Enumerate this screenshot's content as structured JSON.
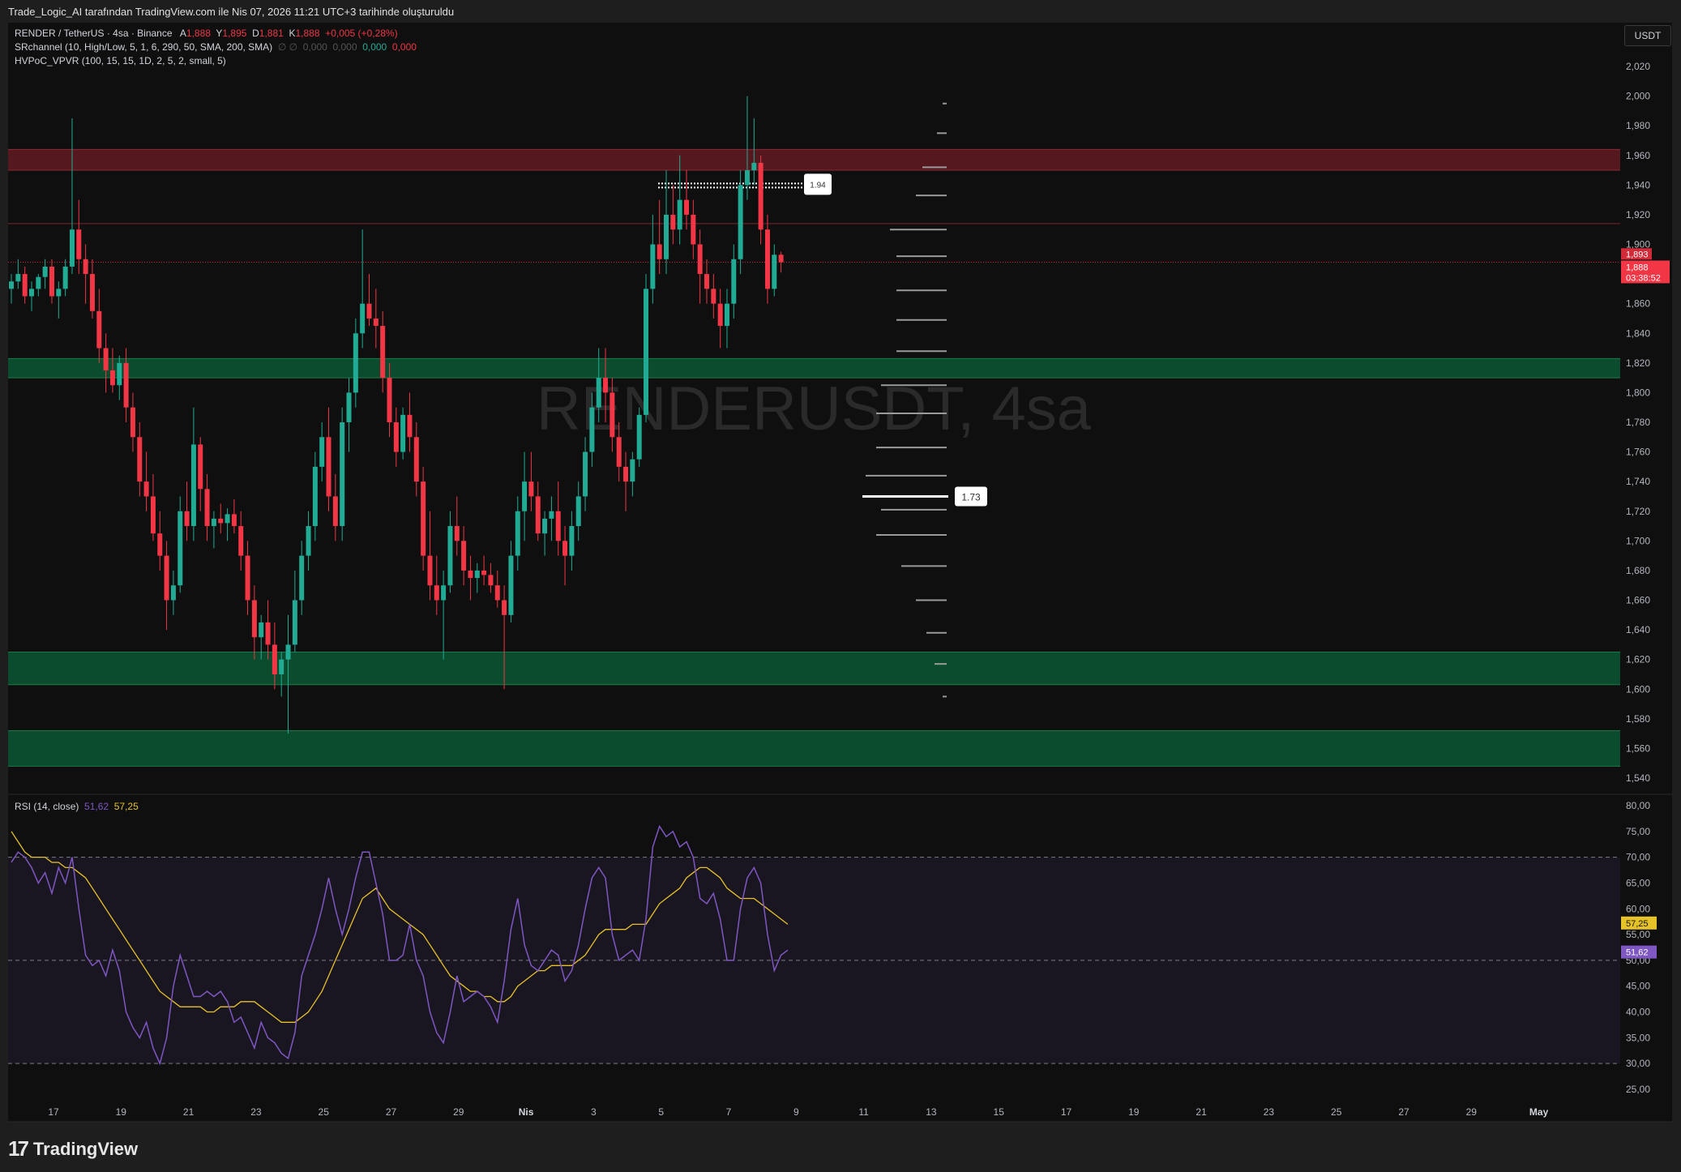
{
  "header": {
    "snapshot_note": "Trade_Logic_AI tarafından TradingView.com ile Nis 07, 2026 11:21 UTC+3 tarihinde oluşturuldu"
  },
  "legend": {
    "symbol": "RENDER / TetherUS · 4sa · Binance",
    "open_label": "A",
    "open": "1,888",
    "high_label": "Y",
    "high": "1,895",
    "low_label": "D",
    "low": "1,881",
    "close_label": "K",
    "close": "1,888",
    "change": "+0,005 (+0,28%)",
    "indicator1": "SRchannel (10, High/Low, 5, 1, 6, 290, 50, SMA, 200, SMA)",
    "indicator1_sym": "∅ ∅",
    "indicator1_vals": [
      "0,000",
      "0,000",
      "0,000",
      "0,000"
    ],
    "indicator2": "HVPoC_VPVR (100, 15, 15, 1D, 2, 5, 2, small, 5)",
    "rsi": "RSI (14, close)",
    "rsi_value": "51,62",
    "rsi_ma_value": "57,25"
  },
  "watermark": "RENDERUSDT, 4sa",
  "currency_button": "USDT",
  "branding": {
    "logo_mark": "17",
    "logo_word": "TradingView"
  },
  "colors": {
    "up": "#22ab94",
    "down": "#f23645",
    "resistance": "#5c1a20",
    "support": "#0c5030",
    "rsi": "#7e57c2",
    "rsi_ma": "#e6c229"
  },
  "chart_data": [
    {
      "type": "candlestick",
      "title": "RENDER / TetherUS · 4sa · Binance",
      "ylim": [
        1.53,
        2.035
      ],
      "y_ticks": [
        "2,020",
        "2,000",
        "1,980",
        "1,960",
        "1,940",
        "1,920",
        "1,900",
        "1,880",
        "1,860",
        "1,840",
        "1,820",
        "1,800",
        "1,780",
        "1,760",
        "1,740",
        "1,720",
        "1,700",
        "1,680",
        "1,660",
        "1,640",
        "1,620",
        "1,600",
        "1,580",
        "1,560",
        "1,540"
      ],
      "x_ticks": [
        "17",
        "19",
        "21",
        "23",
        "25",
        "27",
        "29",
        "Nis",
        "3",
        "5",
        "7",
        "9",
        "11",
        "13",
        "15",
        "17",
        "19",
        "21",
        "23",
        "25",
        "27",
        "29",
        "May"
      ],
      "price_labels": {
        "line": "1,893",
        "last": "1,888",
        "countdown": "03:38:52"
      },
      "zones": [
        {
          "kind": "resistance",
          "from": 1.95,
          "to": 1.964
        },
        {
          "kind": "support",
          "from": 1.81,
          "to": 1.823
        },
        {
          "kind": "support",
          "from": 1.603,
          "to": 1.625
        },
        {
          "kind": "support",
          "from": 1.548,
          "to": 1.572
        }
      ],
      "lines": [
        {
          "kind": "resistance-line",
          "price": 1.914
        },
        {
          "kind": "last-price",
          "price": 1.888
        }
      ],
      "poc_labels": [
        {
          "price": 1.94,
          "text": "1.94"
        },
        {
          "price": 1.73,
          "text": "1.73"
        }
      ],
      "volume_profile": [
        [
          1.995,
          0.05
        ],
        [
          1.975,
          0.12
        ],
        [
          1.952,
          0.3
        ],
        [
          1.933,
          0.38
        ],
        [
          1.91,
          0.7
        ],
        [
          1.892,
          0.62
        ],
        [
          1.869,
          0.62
        ],
        [
          1.849,
          0.62
        ],
        [
          1.828,
          0.62
        ],
        [
          1.805,
          0.81
        ],
        [
          1.786,
          0.87
        ],
        [
          1.763,
          0.87
        ],
        [
          1.744,
          1.0
        ],
        [
          1.721,
          0.81
        ],
        [
          1.704,
          0.87
        ],
        [
          1.683,
          0.56
        ],
        [
          1.66,
          0.38
        ],
        [
          1.638,
          0.25
        ],
        [
          1.617,
          0.15
        ],
        [
          1.595,
          0.05
        ]
      ],
      "ohlc": [
        [
          1.87,
          1.88,
          1.86,
          1.875
        ],
        [
          1.875,
          1.89,
          1.87,
          1.88
        ],
        [
          1.88,
          1.885,
          1.86,
          1.865
        ],
        [
          1.865,
          1.875,
          1.855,
          1.87
        ],
        [
          1.87,
          1.88,
          1.865,
          1.878
        ],
        [
          1.878,
          1.89,
          1.87,
          1.885
        ],
        [
          1.885,
          1.89,
          1.86,
          1.865
        ],
        [
          1.865,
          1.875,
          1.85,
          1.87
        ],
        [
          1.87,
          1.89,
          1.865,
          1.885
        ],
        [
          1.885,
          1.985,
          1.88,
          1.91
        ],
        [
          1.91,
          1.93,
          1.88,
          1.89
        ],
        [
          1.89,
          1.9,
          1.86,
          1.88
        ],
        [
          1.88,
          1.89,
          1.85,
          1.855
        ],
        [
          1.855,
          1.87,
          1.82,
          1.83
        ],
        [
          1.83,
          1.84,
          1.8,
          1.815
        ],
        [
          1.815,
          1.83,
          1.8,
          1.805
        ],
        [
          1.805,
          1.825,
          1.795,
          1.82
        ],
        [
          1.82,
          1.83,
          1.78,
          1.79
        ],
        [
          1.79,
          1.8,
          1.76,
          1.77
        ],
        [
          1.77,
          1.78,
          1.73,
          1.74
        ],
        [
          1.74,
          1.76,
          1.72,
          1.73
        ],
        [
          1.73,
          1.745,
          1.7,
          1.705
        ],
        [
          1.705,
          1.72,
          1.68,
          1.69
        ],
        [
          1.69,
          1.7,
          1.64,
          1.66
        ],
        [
          1.66,
          1.68,
          1.65,
          1.67
        ],
        [
          1.67,
          1.73,
          1.665,
          1.72
        ],
        [
          1.72,
          1.74,
          1.7,
          1.71
        ],
        [
          1.71,
          1.79,
          1.7,
          1.765
        ],
        [
          1.765,
          1.77,
          1.72,
          1.735
        ],
        [
          1.735,
          1.745,
          1.7,
          1.71
        ],
        [
          1.71,
          1.72,
          1.695,
          1.715
        ],
        [
          1.715,
          1.725,
          1.705,
          1.712
        ],
        [
          1.712,
          1.722,
          1.7,
          1.718
        ],
        [
          1.718,
          1.728,
          1.705,
          1.71
        ],
        [
          1.71,
          1.72,
          1.68,
          1.69
        ],
        [
          1.69,
          1.7,
          1.65,
          1.66
        ],
        [
          1.66,
          1.67,
          1.62,
          1.635
        ],
        [
          1.635,
          1.65,
          1.62,
          1.645
        ],
        [
          1.645,
          1.66,
          1.62,
          1.63
        ],
        [
          1.63,
          1.645,
          1.6,
          1.61
        ],
        [
          1.61,
          1.625,
          1.595,
          1.62
        ],
        [
          1.62,
          1.65,
          1.57,
          1.63
        ],
        [
          1.63,
          1.68,
          1.625,
          1.66
        ],
        [
          1.66,
          1.7,
          1.65,
          1.69
        ],
        [
          1.69,
          1.72,
          1.68,
          1.71
        ],
        [
          1.71,
          1.76,
          1.7,
          1.75
        ],
        [
          1.75,
          1.78,
          1.74,
          1.77
        ],
        [
          1.77,
          1.79,
          1.72,
          1.73
        ],
        [
          1.73,
          1.745,
          1.7,
          1.71
        ],
        [
          1.71,
          1.79,
          1.7,
          1.78
        ],
        [
          1.78,
          1.81,
          1.76,
          1.8
        ],
        [
          1.8,
          1.85,
          1.79,
          1.84
        ],
        [
          1.84,
          1.91,
          1.83,
          1.86
        ],
        [
          1.86,
          1.88,
          1.845,
          1.85
        ],
        [
          1.85,
          1.87,
          1.83,
          1.845
        ],
        [
          1.845,
          1.855,
          1.8,
          1.81
        ],
        [
          1.81,
          1.82,
          1.77,
          1.78
        ],
        [
          1.78,
          1.79,
          1.75,
          1.76
        ],
        [
          1.76,
          1.79,
          1.755,
          1.785
        ],
        [
          1.785,
          1.8,
          1.76,
          1.77
        ],
        [
          1.77,
          1.78,
          1.73,
          1.74
        ],
        [
          1.74,
          1.75,
          1.68,
          1.69
        ],
        [
          1.69,
          1.72,
          1.66,
          1.67
        ],
        [
          1.67,
          1.69,
          1.65,
          1.66
        ],
        [
          1.66,
          1.68,
          1.62,
          1.67
        ],
        [
          1.67,
          1.72,
          1.665,
          1.71
        ],
        [
          1.71,
          1.73,
          1.69,
          1.7
        ],
        [
          1.7,
          1.71,
          1.67,
          1.68
        ],
        [
          1.68,
          1.69,
          1.66,
          1.675
        ],
        [
          1.675,
          1.685,
          1.665,
          1.68
        ],
        [
          1.68,
          1.69,
          1.67,
          1.677
        ],
        [
          1.677,
          1.685,
          1.665,
          1.67
        ],
        [
          1.67,
          1.68,
          1.655,
          1.66
        ],
        [
          1.66,
          1.67,
          1.6,
          1.65
        ],
        [
          1.65,
          1.7,
          1.645,
          1.69
        ],
        [
          1.69,
          1.73,
          1.68,
          1.72
        ],
        [
          1.72,
          1.76,
          1.7,
          1.74
        ],
        [
          1.74,
          1.76,
          1.72,
          1.73
        ],
        [
          1.73,
          1.74,
          1.7,
          1.705
        ],
        [
          1.705,
          1.72,
          1.69,
          1.715
        ],
        [
          1.715,
          1.73,
          1.7,
          1.72
        ],
        [
          1.72,
          1.74,
          1.69,
          1.7
        ],
        [
          1.7,
          1.71,
          1.67,
          1.69
        ],
        [
          1.69,
          1.72,
          1.68,
          1.71
        ],
        [
          1.71,
          1.74,
          1.7,
          1.73
        ],
        [
          1.73,
          1.77,
          1.72,
          1.76
        ],
        [
          1.76,
          1.8,
          1.75,
          1.79
        ],
        [
          1.79,
          1.83,
          1.78,
          1.81
        ],
        [
          1.81,
          1.83,
          1.78,
          1.8
        ],
        [
          1.8,
          1.81,
          1.76,
          1.77
        ],
        [
          1.77,
          1.78,
          1.74,
          1.75
        ],
        [
          1.75,
          1.76,
          1.72,
          1.74
        ],
        [
          1.74,
          1.76,
          1.73,
          1.755
        ],
        [
          1.755,
          1.79,
          1.75,
          1.785
        ],
        [
          1.785,
          1.88,
          1.78,
          1.87
        ],
        [
          1.87,
          1.92,
          1.86,
          1.9
        ],
        [
          1.9,
          1.93,
          1.88,
          1.89
        ],
        [
          1.89,
          1.95,
          1.88,
          1.92
        ],
        [
          1.92,
          1.94,
          1.9,
          1.91
        ],
        [
          1.91,
          1.96,
          1.9,
          1.93
        ],
        [
          1.93,
          1.95,
          1.91,
          1.92
        ],
        [
          1.92,
          1.93,
          1.89,
          1.9
        ],
        [
          1.9,
          1.91,
          1.86,
          1.88
        ],
        [
          1.88,
          1.89,
          1.86,
          1.87
        ],
        [
          1.87,
          1.88,
          1.85,
          1.86
        ],
        [
          1.86,
          1.87,
          1.83,
          1.845
        ],
        [
          1.845,
          1.87,
          1.83,
          1.86
        ],
        [
          1.86,
          1.9,
          1.85,
          1.89
        ],
        [
          1.89,
          1.95,
          1.88,
          1.94
        ],
        [
          1.94,
          2.0,
          1.93,
          1.95
        ],
        [
          1.95,
          1.985,
          1.94,
          1.955
        ],
        [
          1.955,
          1.96,
          1.9,
          1.91
        ],
        [
          1.91,
          1.92,
          1.86,
          1.87
        ],
        [
          1.87,
          1.9,
          1.865,
          1.893
        ],
        [
          1.893,
          1.895,
          1.881,
          1.888
        ]
      ]
    },
    {
      "type": "line",
      "title": "RSI (14, close)",
      "ylim": [
        24,
        80.5
      ],
      "y_ticks": [
        "80,00",
        "75,00",
        "70,00",
        "65,00",
        "60,00",
        "55,00",
        "50,00",
        "45,00",
        "40,00",
        "35,00",
        "30,00",
        "25,00"
      ],
      "bands": {
        "upper": 70,
        "middle": 50,
        "lower": 30
      },
      "end_labels": {
        "rsi": "51,62",
        "rsi_ma": "57,25"
      },
      "series": [
        {
          "name": "RSI",
          "values": [
            69,
            71,
            70,
            68,
            65,
            67,
            63,
            68,
            65,
            70,
            60,
            51,
            49,
            50,
            47,
            52,
            48,
            40,
            37,
            35,
            38,
            33,
            30,
            35,
            45,
            51,
            47,
            43,
            43,
            44,
            43,
            44,
            42,
            38,
            39,
            36,
            33,
            38,
            35,
            34,
            32,
            31,
            36,
            47,
            51,
            55,
            60,
            66,
            60,
            55,
            60,
            66,
            71,
            71,
            65,
            59,
            50,
            50,
            51,
            57,
            50,
            47,
            40,
            36,
            34,
            40,
            47,
            42,
            43,
            44,
            43,
            41,
            38,
            46,
            56,
            62,
            53,
            49,
            48,
            50,
            52,
            51,
            46,
            48,
            53,
            60,
            66,
            68,
            66,
            55,
            50,
            51,
            52,
            50,
            58,
            72,
            76,
            74,
            75,
            72,
            73,
            70,
            62,
            61,
            63,
            58,
            50,
            50,
            60,
            66,
            68,
            65,
            55,
            48,
            51,
            52
          ]
        },
        {
          "name": "RSI-based MA",
          "values": [
            75,
            73,
            71,
            70,
            70,
            70,
            69,
            69,
            68,
            68,
            67,
            66,
            64,
            62,
            60,
            58,
            56,
            54,
            52,
            50,
            48,
            46,
            44,
            43,
            42,
            41,
            41,
            41,
            41,
            40,
            40,
            41,
            41,
            41,
            42,
            42,
            42,
            41,
            40,
            39,
            38,
            38,
            38,
            39,
            40,
            42,
            44,
            47,
            50,
            53,
            56,
            59,
            62,
            63,
            64,
            62,
            60,
            59,
            58,
            57,
            56,
            55,
            53,
            51,
            49,
            47,
            46,
            45,
            44,
            44,
            43,
            43,
            42,
            42,
            43,
            45,
            46,
            47,
            48,
            48,
            49,
            49,
            49,
            49,
            50,
            51,
            53,
            55,
            56,
            56,
            56,
            56,
            57,
            57,
            57,
            59,
            61,
            62,
            63,
            64,
            66,
            67,
            68,
            68,
            67,
            66,
            64,
            63,
            62,
            62,
            62,
            61,
            60,
            59,
            58,
            57
          ]
        }
      ]
    }
  ]
}
